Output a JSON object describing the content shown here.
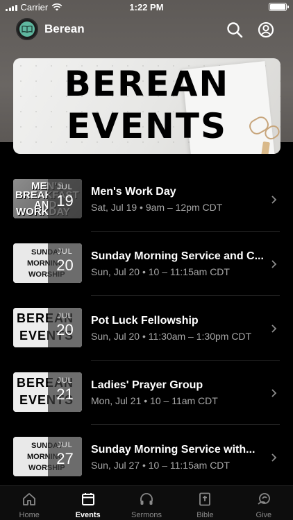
{
  "status": {
    "carrier": "Carrier",
    "time": "1:22 PM"
  },
  "header": {
    "title": "Berean",
    "search_icon": "search-icon",
    "account_icon": "account-icon"
  },
  "banner": {
    "line1": "BEREAN",
    "line2": "EVENTS"
  },
  "events": [
    {
      "title": "Men's Work Day",
      "meta": "Sat, Jul 19 • 9am – 12pm CDT",
      "month": "JUL",
      "day": "19",
      "art": [
        "MEN'S",
        "BREAKFAST",
        "AND",
        "WORKDAY"
      ]
    },
    {
      "title": "Sunday Morning Service and C...",
      "meta": "Sun, Jul 20 • 10 – 11:15am CDT",
      "month": "JUL",
      "day": "20",
      "art": [
        "SUNDAY",
        "MORNING",
        "WORSHIP"
      ]
    },
    {
      "title": "Pot Luck Fellowship",
      "meta": "Sun, Jul 20 • 11:30am – 1:30pm CDT",
      "month": "JUL",
      "day": "20",
      "art": [
        "BEREAN",
        "EVENTS"
      ]
    },
    {
      "title": "Ladies' Prayer Group",
      "meta": "Mon, Jul 21 • 10 – 11am CDT",
      "month": "JUL",
      "day": "21",
      "art": [
        "BEREAN",
        "EVENTS"
      ]
    },
    {
      "title": "Sunday Morning Service with...",
      "meta": "Sun, Jul 27 • 10 – 11:15am CDT",
      "month": "JUL",
      "day": "27",
      "art": [
        "SUNDAY",
        "MORNING",
        "WORSHIP"
      ]
    }
  ],
  "tabs": [
    {
      "label": "Home",
      "icon": "home-icon",
      "active": false
    },
    {
      "label": "Events",
      "icon": "calendar-icon",
      "active": true
    },
    {
      "label": "Sermons",
      "icon": "headphones-icon",
      "active": false
    },
    {
      "label": "Bible",
      "icon": "bible-icon",
      "active": false
    },
    {
      "label": "Give",
      "icon": "give-icon",
      "active": false
    }
  ]
}
